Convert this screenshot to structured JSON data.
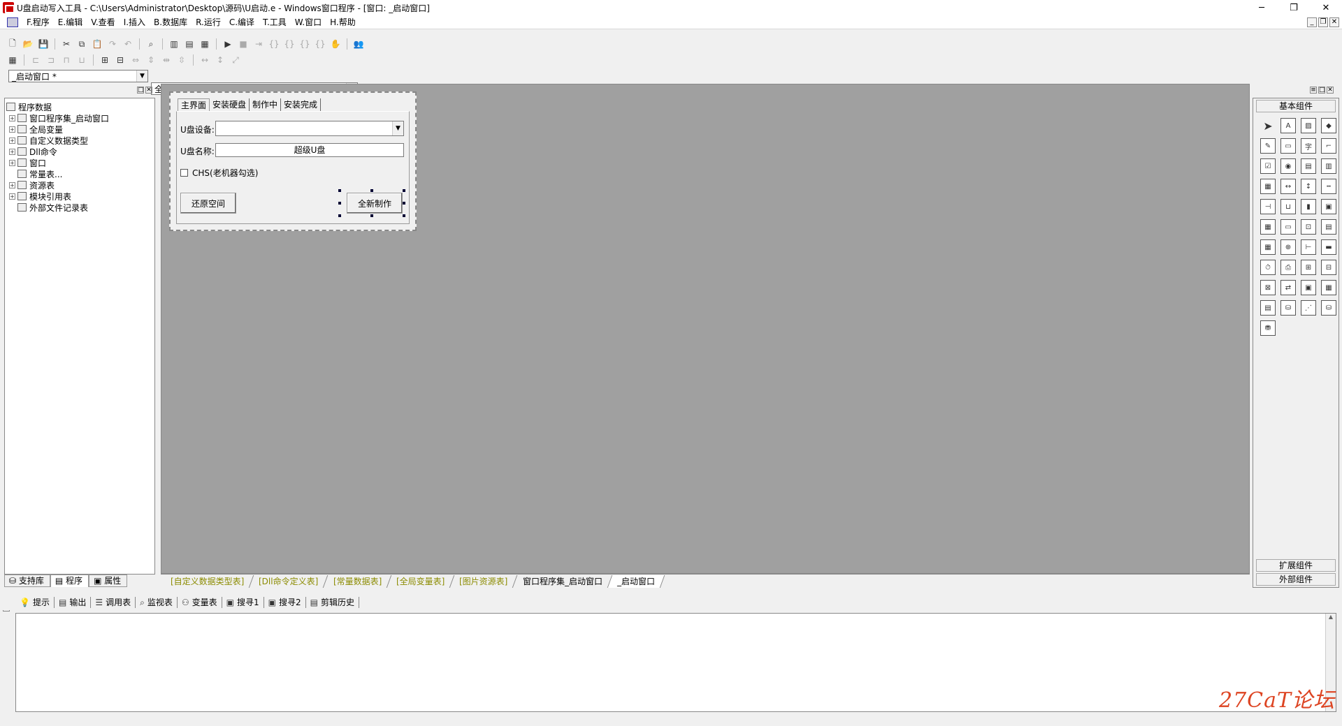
{
  "window": {
    "title": "U盘启动写入工具 - C:\\Users\\Administrator\\Desktop\\源码\\U启动.e - Windows窗口程序 - [窗口: _启动窗口]",
    "minimize": "─",
    "maximize": "❐",
    "close": "✕"
  },
  "menu": [
    "F.程序",
    "E.编辑",
    "V.查看",
    "I.插入",
    "B.数据库",
    "R.运行",
    "C.编译",
    "T.工具",
    "W.窗口",
    "H.帮助"
  ],
  "mdi_buttons": [
    "_",
    "❐",
    "✕"
  ],
  "combos": {
    "window_combo": "_启动窗口 *",
    "component_combo": "全新制作"
  },
  "left_panel": {
    "tree": [
      {
        "label": "程序数据",
        "expander": "",
        "indent": 0
      },
      {
        "label": "窗口程序集_启动窗口",
        "expander": "+",
        "indent": 1
      },
      {
        "label": "全局变量",
        "expander": "+",
        "indent": 1
      },
      {
        "label": "自定义数据类型",
        "expander": "+",
        "indent": 1
      },
      {
        "label": "Dll命令",
        "expander": "+",
        "indent": 1
      },
      {
        "label": "窗口",
        "expander": "+",
        "indent": 1
      },
      {
        "label": "常量表...",
        "expander": "",
        "indent": 1
      },
      {
        "label": "资源表",
        "expander": "+",
        "indent": 1
      },
      {
        "label": "模块引用表",
        "expander": "+",
        "indent": 1
      },
      {
        "label": "外部文件记录表",
        "expander": "",
        "indent": 1
      }
    ],
    "tabs": [
      "支持库",
      "程序",
      "属性"
    ]
  },
  "form": {
    "tabs": [
      "主界面",
      "安装硬盘",
      "制作中",
      "安装完成"
    ],
    "device_label": "U盘设备:",
    "device_value": "",
    "name_label": "U盘名称:",
    "name_value": "超级U盘",
    "chs_label": "CHS(老机器勾选)",
    "restore_button": "还原空间",
    "create_button": "全新制作"
  },
  "doc_tabs": [
    "[自定义数据类型表]",
    "[Dll命令定义表]",
    "[常量数据表]",
    "[全局变量表]",
    "[图片资源表]",
    "窗口程序集_启动窗口",
    "_启动窗口"
  ],
  "right_panel": {
    "basic_title": "基本组件",
    "extended_title": "扩展组件",
    "external_title": "外部组件"
  },
  "output_tabs": [
    "提示",
    "输出",
    "调用表",
    "监视表",
    "变量表",
    "搜寻1",
    "搜寻2",
    "剪辑历史"
  ],
  "watermark": "27CaT论坛"
}
